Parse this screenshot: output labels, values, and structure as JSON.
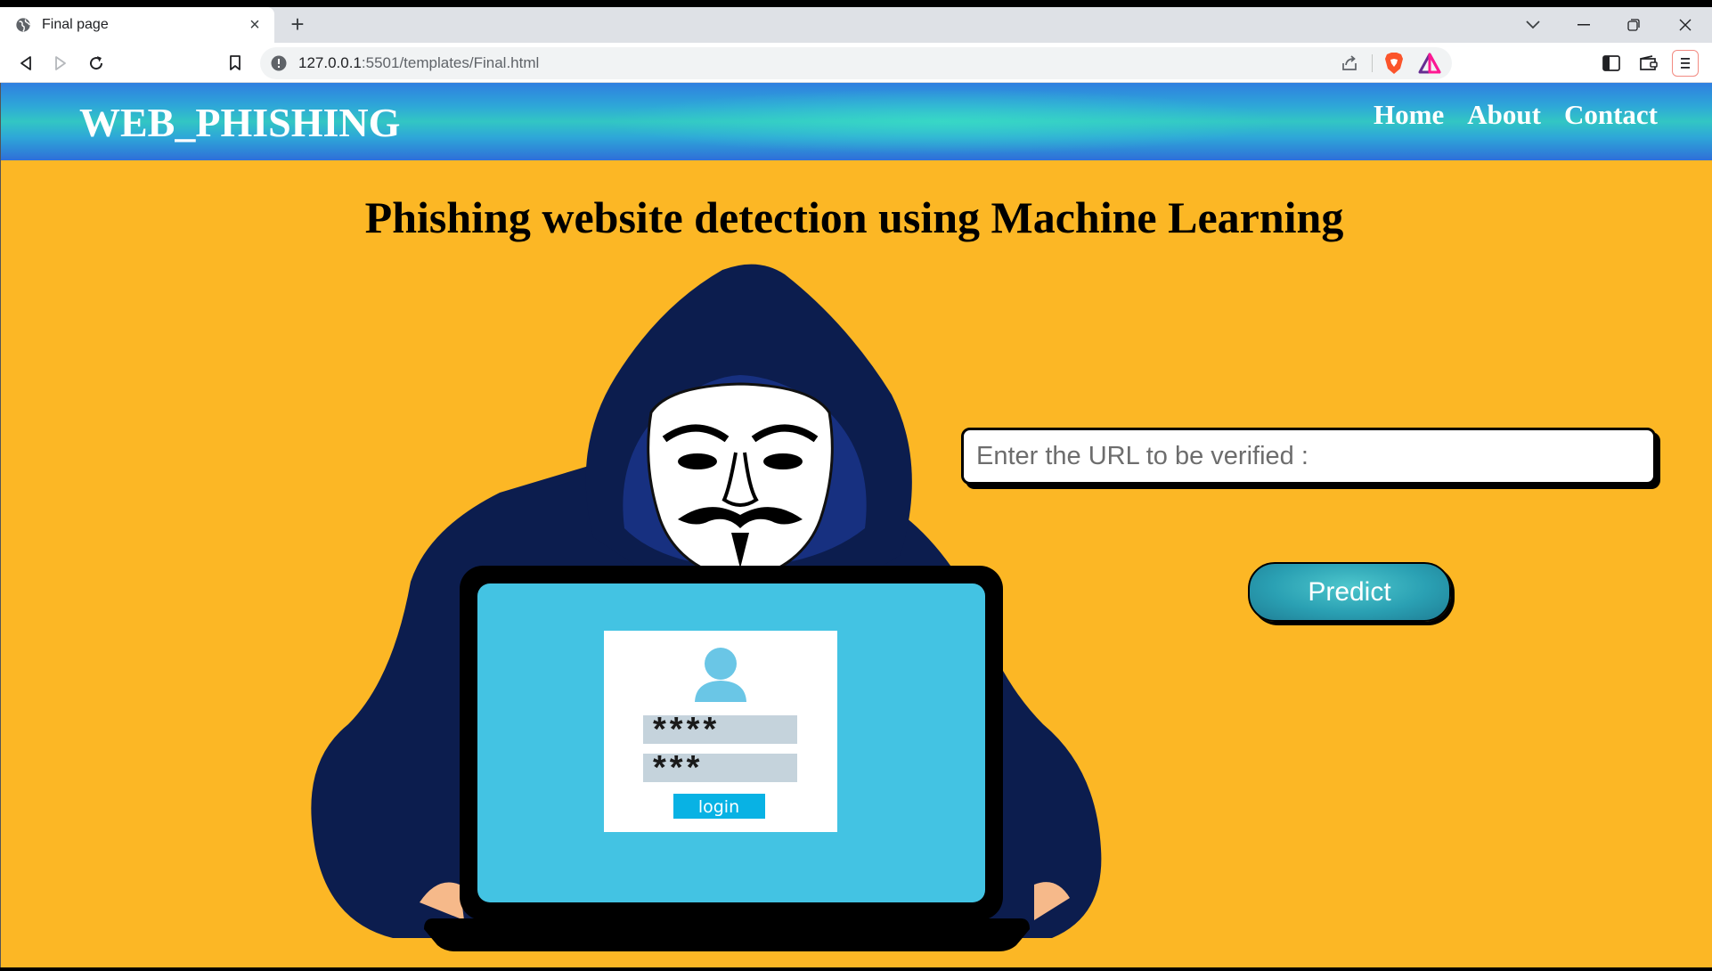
{
  "browser": {
    "tab_title": "Final page",
    "url_host": "127.0.0.1",
    "url_rest": ":5501/templates/Final.html"
  },
  "icons": {
    "tab_favicon": "globe-icon",
    "back": "back-arrow-icon",
    "forward": "forward-arrow-icon",
    "reload": "reload-icon",
    "bookmark": "bookmark-icon",
    "site_info": "info-icon",
    "share": "share-icon",
    "brave": "brave-shield-icon",
    "rewards": "brave-rewards-icon",
    "sidebar": "sidebar-icon",
    "wallet": "wallet-icon",
    "menu": "menu-icon"
  },
  "page": {
    "brand": "WEB_PHISHING",
    "nav": {
      "home": "Home",
      "about": "About",
      "contact": "Contact"
    },
    "headline": "Phishing website detection using Machine Learning",
    "url_placeholder": "Enter the URL to be verified :",
    "predict_label": "Predict",
    "illustration": {
      "password_1": "****",
      "password_2": "***",
      "login_label": "login"
    }
  },
  "colors": {
    "page_background": "#fcb725",
    "navbar_gradient_start": "#2f7fe0",
    "navbar_gradient_mid": "#32c6c4",
    "predict_button": "#2aa0b3",
    "hoodie": "#0c1d4e",
    "laptop_screen": "#43c3e3"
  }
}
